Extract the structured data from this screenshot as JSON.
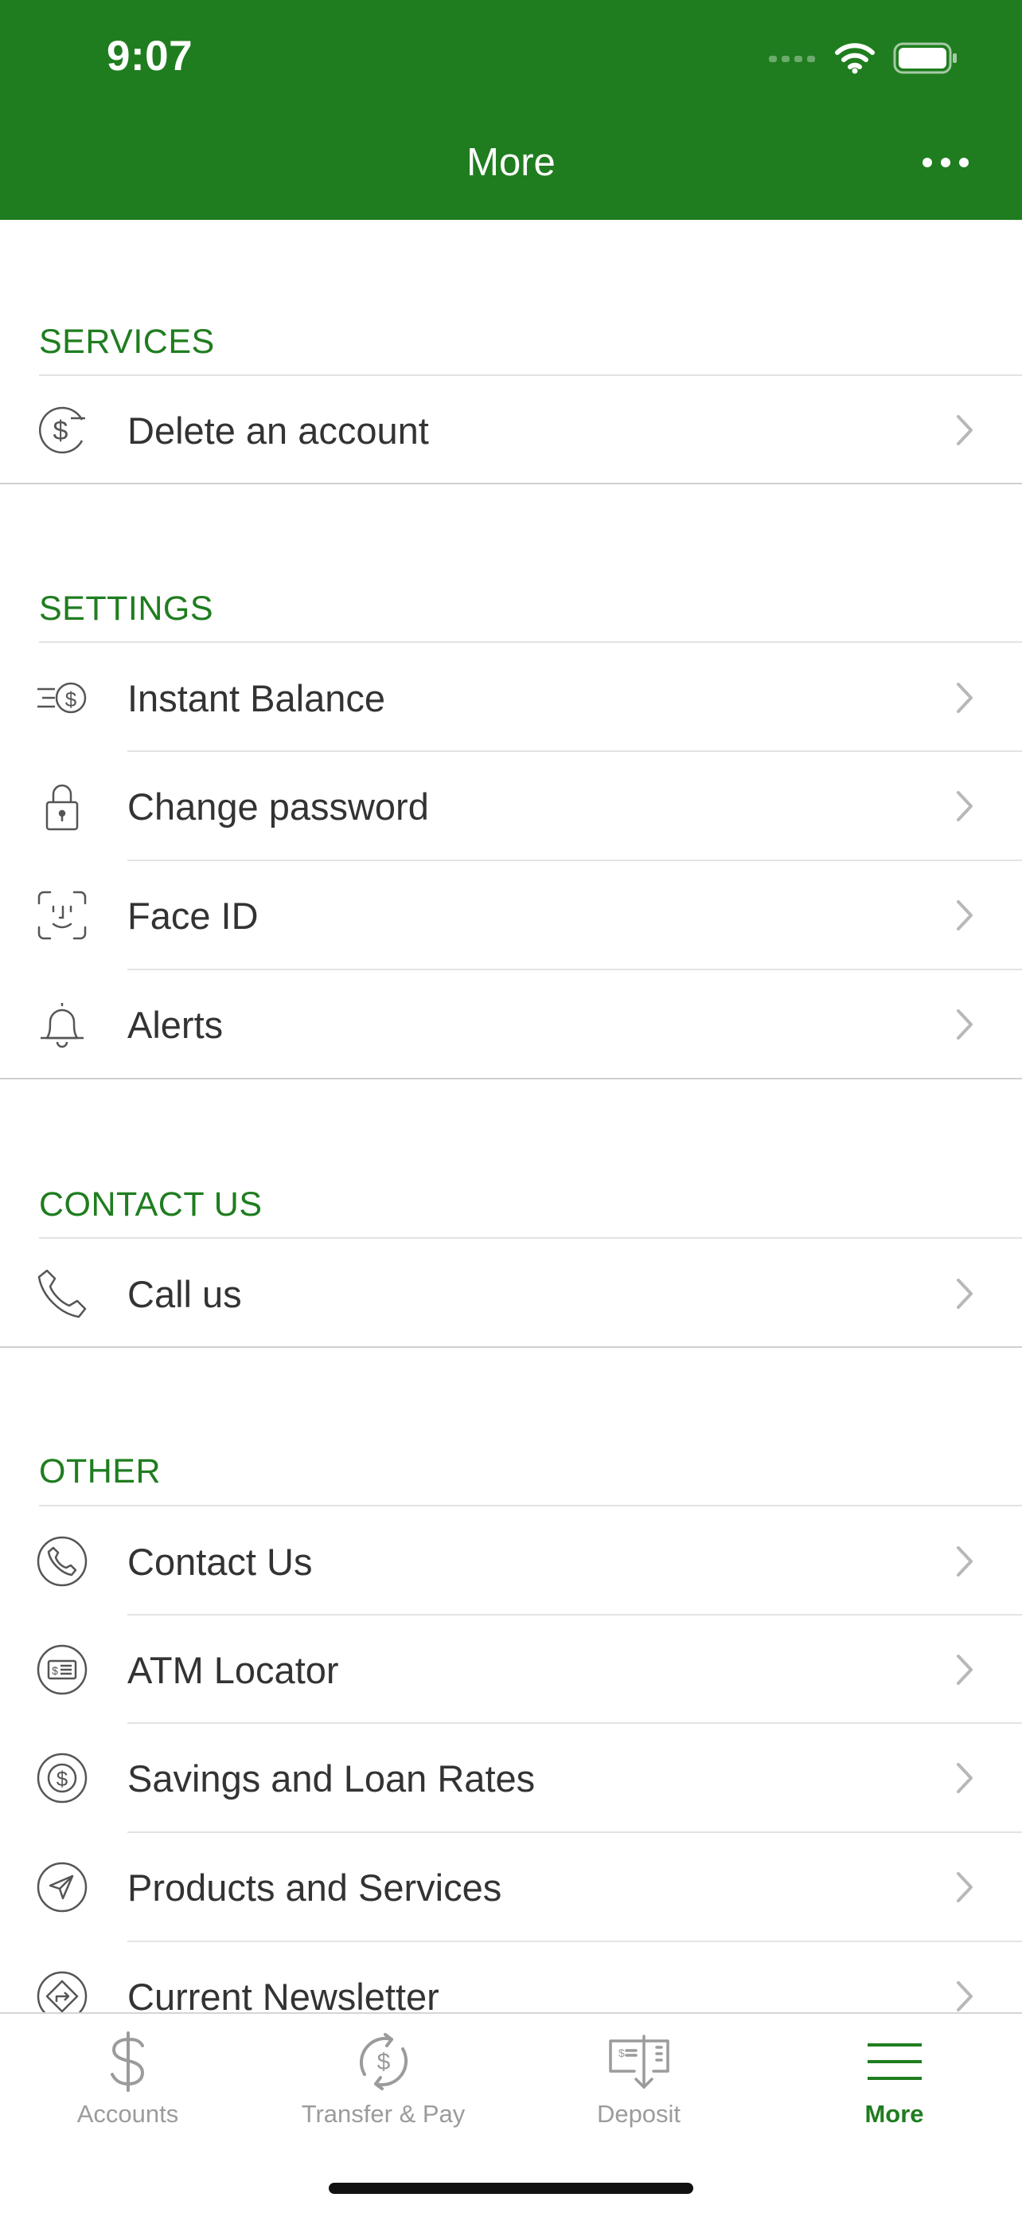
{
  "status": {
    "time": "9:07"
  },
  "nav": {
    "title": "More"
  },
  "sections": {
    "services": {
      "title": "SERVICES",
      "items": [
        "Delete an account"
      ]
    },
    "settings": {
      "title": "SETTINGS",
      "items": [
        "Instant Balance",
        "Change password",
        "Face ID",
        "Alerts"
      ]
    },
    "contact": {
      "title": "CONTACT US",
      "items": [
        "Call us"
      ]
    },
    "other": {
      "title": "OTHER",
      "items": [
        "Contact Us",
        "ATM Locator",
        "Savings and Loan Rates",
        "Products and Services",
        "Current Newsletter"
      ]
    }
  },
  "icons": {
    "services": [
      "dollar-minus-icon"
    ],
    "settings": [
      "fast-dollar-icon",
      "lock-icon",
      "face-id-icon",
      "bell-icon"
    ],
    "contact": [
      "phone-icon"
    ],
    "other": [
      "phone-circle-icon",
      "atm-card-icon",
      "dollar-circle-icon",
      "paper-plane-icon",
      "directions-icon"
    ]
  },
  "tabs": [
    {
      "label": "Accounts",
      "icon": "dollar-icon",
      "active": false
    },
    {
      "label": "Transfer & Pay",
      "icon": "transfer-icon",
      "active": false
    },
    {
      "label": "Deposit",
      "icon": "check-deposit-icon",
      "active": false
    },
    {
      "label": "More",
      "icon": "menu-icon",
      "active": true
    }
  ],
  "colors": {
    "brand": "#1f7d1f",
    "text": "#333333",
    "tab_inactive": "#9b9b9b"
  }
}
